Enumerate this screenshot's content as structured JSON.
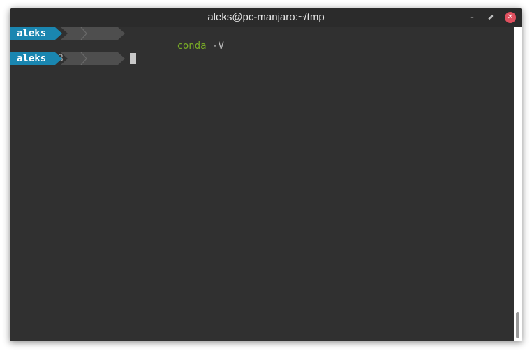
{
  "window": {
    "title": "aleks@pc-manjaro:~/tmp",
    "minimize_icon": "minimize-icon",
    "maximize_icon": "maximize-icon",
    "close_icon": "close-icon"
  },
  "prompt": {
    "user": "aleks",
    "home": "~",
    "cwd": "tmp"
  },
  "lines": [
    {
      "command": "conda",
      "args": " -V"
    },
    {
      "output": "conda 4.8.3"
    }
  ],
  "colors": {
    "terminal_bg": "#303030",
    "user_segment": "#1a86b0",
    "dir_segment": "#4e4e4e",
    "command_green": "#78ab26",
    "close_button": "#e0505f"
  }
}
